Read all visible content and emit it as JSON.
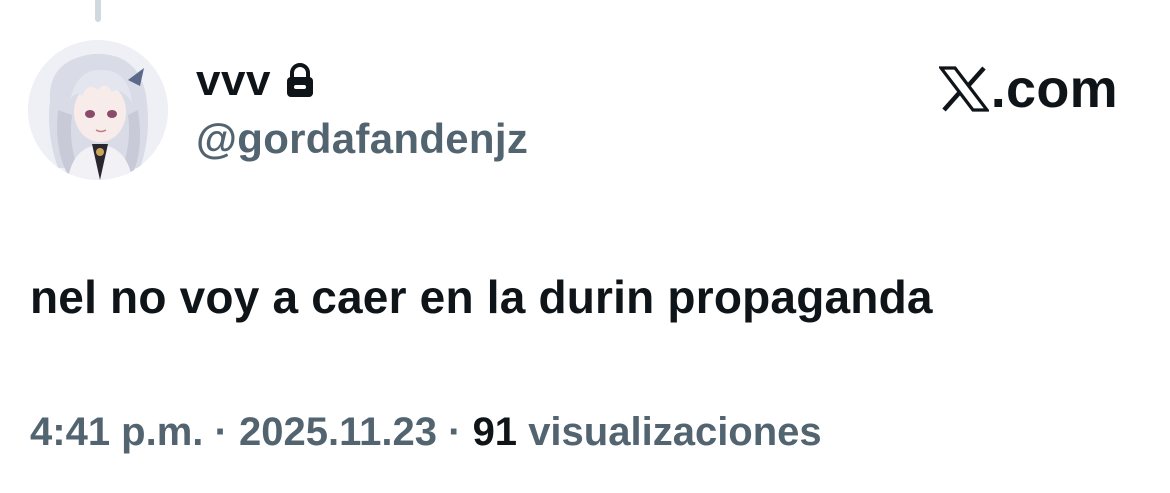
{
  "tweet": {
    "author": {
      "display_name": "vvv",
      "handle": "@gordafandenjz",
      "protected_icon": "lock-icon",
      "avatar_icon": "anime-character-avatar"
    },
    "brand": {
      "logo_icon": "x-logo-icon",
      "text": ".com"
    },
    "text": "nel no voy a caer en la durin propaganda",
    "meta": {
      "time": "4:41 p.m.",
      "separator": "·",
      "date": "2025.11.23",
      "views_count": "91",
      "views_label": "visualizaciones"
    }
  },
  "colors": {
    "primary_text": "#0f1419",
    "secondary_text": "#536471",
    "background": "#ffffff",
    "thread_line": "#cfd9de"
  }
}
